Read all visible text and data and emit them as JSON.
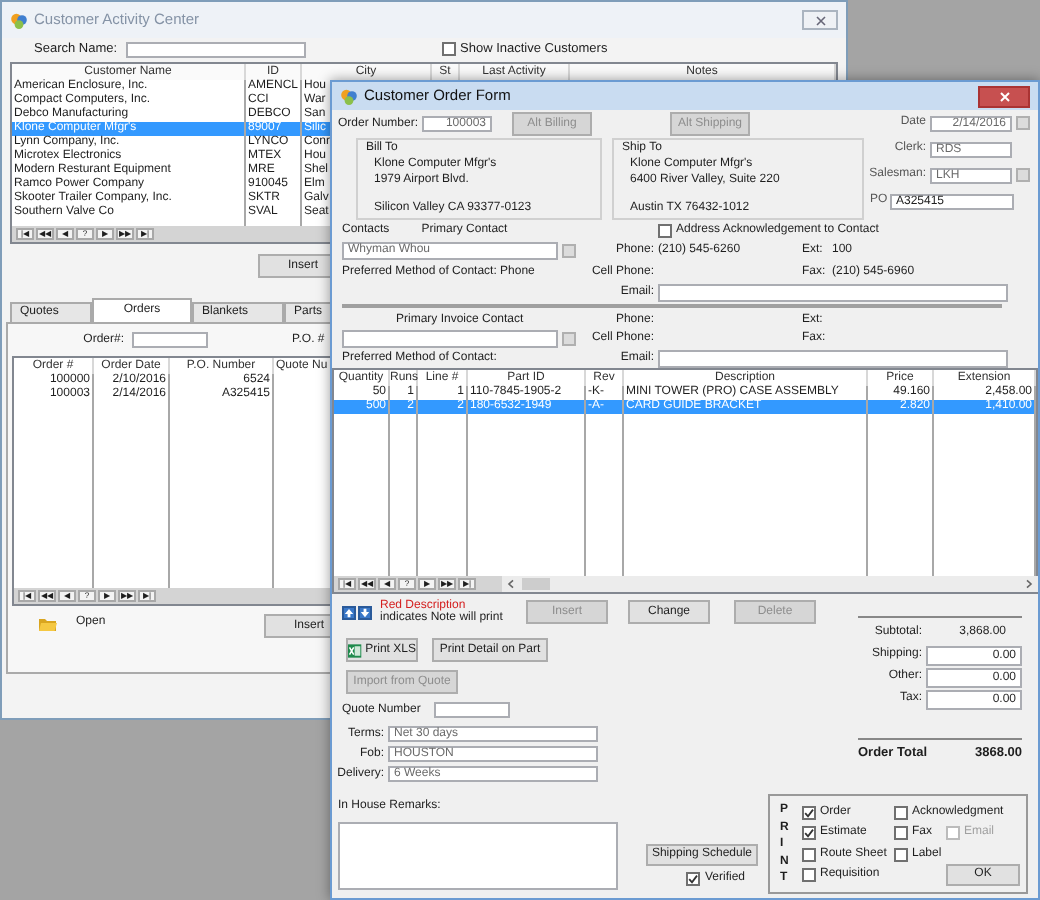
{
  "customer_activity_center": {
    "title": "Customer Activity Center",
    "search_label": "Search Name:",
    "show_inactive": {
      "label": "Show Inactive Customers",
      "checked": false
    },
    "customer_table": {
      "columns": [
        "Customer Name",
        "ID",
        "City",
        "St",
        "Last Activity",
        "Notes"
      ],
      "rows": [
        {
          "name": "American Enclosure, Inc.",
          "id": "AMENCL",
          "city": "Hou",
          "selected": false
        },
        {
          "name": "Compact Computers, Inc.",
          "id": "CCI",
          "city": "War",
          "selected": false
        },
        {
          "name": "Debco Manufacturing",
          "id": "DEBCO",
          "city": "San",
          "selected": false
        },
        {
          "name": "Klone Computer Mfgr's",
          "id": "89007",
          "city": "Silic",
          "selected": true
        },
        {
          "name": "Lynn Company, Inc.",
          "id": "LYNCO",
          "city": "Conr",
          "selected": false
        },
        {
          "name": "Microtex Electronics",
          "id": "MTEX",
          "city": "Hou",
          "selected": false
        },
        {
          "name": "Modern Resturant Equipment",
          "id": "MRE",
          "city": "Shel",
          "selected": false
        },
        {
          "name": "Ramco Power Company",
          "id": "910045",
          "city": "Elm",
          "selected": false
        },
        {
          "name": "Skooter Trailer Company, Inc.",
          "id": "SKTR",
          "city": "Galv",
          "selected": false
        },
        {
          "name": "Southern Valve Co",
          "id": "SVAL",
          "city": "Seat",
          "selected": false
        }
      ]
    },
    "navigator": [
      "|◀",
      "◀◀",
      "◀",
      "?",
      "▶",
      "▶▶",
      "▶|"
    ],
    "insert_button": "Insert",
    "tabs": [
      {
        "label": "Quotes",
        "selected": false
      },
      {
        "label": "Orders",
        "selected": true
      },
      {
        "label": "Blankets",
        "selected": false
      },
      {
        "label": "Parts",
        "selected": false
      }
    ],
    "order_filter_label": "Order#:",
    "po_filter_label": "P.O. #",
    "orders_table": {
      "columns": [
        "Order #",
        "Order Date",
        "P.O. Number",
        "Quote Nu"
      ],
      "rows": [
        {
          "order": "100000",
          "date": "2/10/2016",
          "po": "6524"
        },
        {
          "order": "100003",
          "date": "2/14/2016",
          "po": "A325415"
        }
      ]
    },
    "orders_navigator": [
      "|◀",
      "◀◀",
      "◀",
      "?",
      "▶",
      "▶▶",
      "▶|"
    ],
    "open_label": "Open",
    "orders_insert_button": "Insert"
  },
  "customer_order_form": {
    "title": "Customer Order Form",
    "order_number": {
      "label": "Order Number:",
      "value": "100003",
      "disabled": true
    },
    "alt_billing": {
      "label": "Alt Billing",
      "disabled": true
    },
    "alt_shipping": {
      "label": "Alt Shipping",
      "disabled": true
    },
    "side_fields": [
      {
        "kind": "date",
        "label": "Date",
        "value": "2/14/2016",
        "disabled": true
      },
      {
        "kind": "clerk",
        "label": "Clerk:",
        "value": "RDS",
        "disabled": true
      },
      {
        "kind": "salesman",
        "label": "Salesman:",
        "value": "LKH",
        "disabled": true
      },
      {
        "kind": "po",
        "label": "PO",
        "value": "A325415",
        "disabled": false
      }
    ],
    "bill_to": {
      "title": "Bill To",
      "name": "Klone Computer Mfgr's",
      "street": "1979 Airport Blvd.",
      "city_line": "Silicon Valley CA 93377-0123"
    },
    "ship_to": {
      "title": "Ship To",
      "name": "Klone Computer Mfgr's",
      "street": "6400 River Valley, Suite 220",
      "city_line": "Austin TX 76432-1012"
    },
    "contacts_label": "Contacts",
    "address_ack": {
      "label": "Address Acknowledgement to Contact",
      "checked": false
    },
    "primary_contact": {
      "heading": "Primary Contact",
      "name": "Whyman Whou",
      "preferred_method": "Preferred Method of Contact: Phone",
      "phone_label": "Phone:",
      "phone": "(210) 545-6260",
      "ext_label": "Ext:",
      "ext": "100",
      "cell_label": "Cell Phone:",
      "fax_label": "Fax:",
      "fax": "(210) 545-6960",
      "email_label": "Email:"
    },
    "invoice_contact": {
      "heading": "Primary Invoice Contact",
      "preferred_method": "Preferred Method of Contact:",
      "phone_label": "Phone:",
      "ext_label": "Ext:",
      "cell_label": "Cell Phone:",
      "fax_label": "Fax:",
      "email_label": "Email:"
    },
    "lines_table": {
      "columns": [
        "Quantity",
        "Runs",
        "Line #",
        "Part ID",
        "Rev",
        "Description",
        "Price",
        "Extension"
      ],
      "rows": [
        {
          "quantity": "50",
          "runs": "1",
          "line": "1",
          "part_id": "110-7845-1905-2",
          "rev": "-K-",
          "description": "MINI TOWER (PRO) CASE ASSEMBLY",
          "price": "49.160",
          "extension": "2,458.00",
          "selected": false
        },
        {
          "quantity": "500",
          "runs": "2",
          "line": "2",
          "part_id": "180-6532-1949",
          "rev": "-A-",
          "description": "CARD GUIDE BRACKET",
          "price": "2.820",
          "extension": "1,410.00",
          "selected": true
        }
      ]
    },
    "lines_navigator": [
      "|◀",
      "◀◀",
      "◀",
      "?",
      "▶",
      "▶▶",
      "▶|"
    ],
    "note_legend": {
      "red_text": "Red Description",
      "text": "indicates Note will print"
    },
    "line_buttons": [
      {
        "label": "Insert",
        "disabled": true
      },
      {
        "label": "Change",
        "disabled": false
      },
      {
        "label": "Delete",
        "disabled": true
      }
    ],
    "print_xls": "Print XLS",
    "print_detail": "Print Detail on Part",
    "import_from_quote": {
      "label": "Import from Quote",
      "disabled": true
    },
    "quote_number_label": "Quote Number",
    "terms": [
      {
        "label": "Terms:",
        "value": "Net 30 days"
      },
      {
        "label": "Fob:",
        "value": "HOUSTON"
      },
      {
        "label": "Delivery:",
        "value": "6 Weeks"
      }
    ],
    "subtotal": {
      "label": "Subtotal:",
      "value": "3,868.00"
    },
    "charges": [
      {
        "label": "Shipping:",
        "value": "0.00"
      },
      {
        "label": "Other:",
        "value": "0.00"
      },
      {
        "label": "Tax:",
        "value": "0.00"
      }
    ],
    "order_total": {
      "label": "Order Total",
      "value": "3868.00"
    },
    "remarks_label": "In House Remarks:",
    "shipping_schedule": "Shipping Schedule",
    "verified": {
      "label": "Verified",
      "checked": true
    },
    "print_box": {
      "label": "PRINT",
      "options": [
        {
          "label": "Order",
          "checked": true,
          "disabled": false
        },
        {
          "label": "Acknowledgment",
          "checked": false,
          "disabled": false
        },
        {
          "label": "Estimate",
          "checked": true,
          "disabled": false
        },
        {
          "label": "Fax",
          "checked": false,
          "disabled": false
        },
        {
          "label": "Email",
          "checked": false,
          "disabled": true
        },
        {
          "label": "Route Sheet",
          "checked": false,
          "disabled": false
        },
        {
          "label": "Label",
          "checked": false,
          "disabled": false
        },
        {
          "label": "Requisition",
          "checked": false,
          "disabled": false
        }
      ],
      "ok": "OK"
    }
  }
}
